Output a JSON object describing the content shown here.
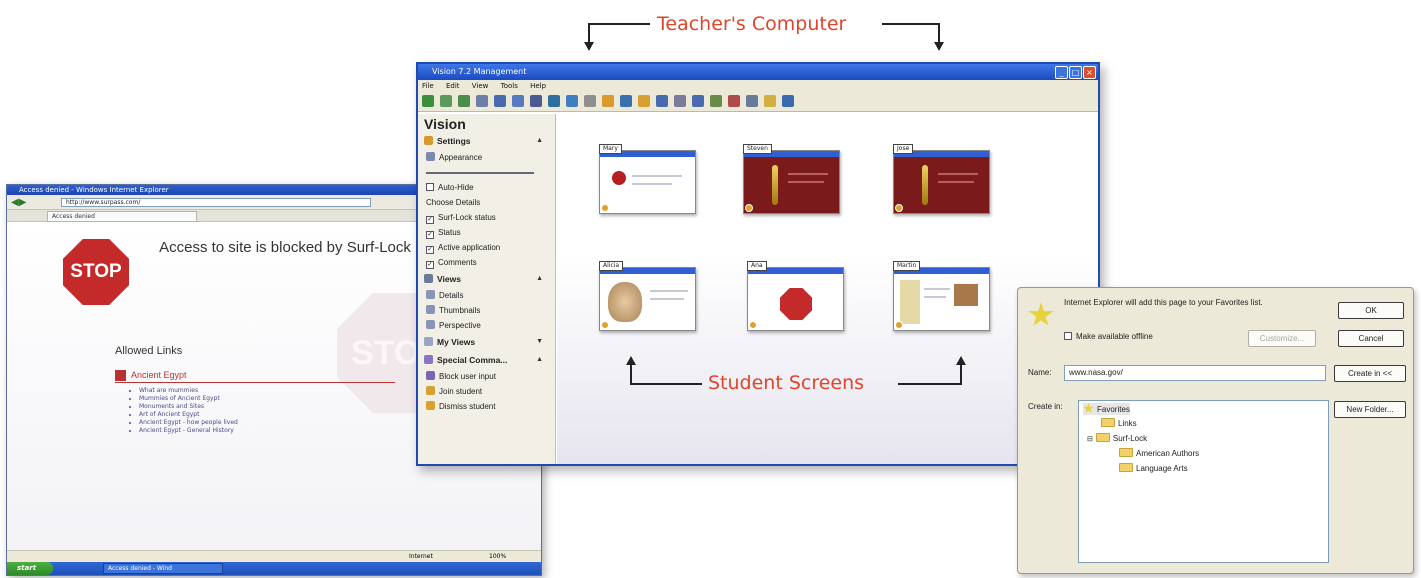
{
  "callouts": {
    "teacher": "Teacher's Computer",
    "students": "Student Screens"
  },
  "ie_window": {
    "title": "Access denied - Windows Internet Explorer",
    "address": "http://www.surpass.com/",
    "tab": "Access denied",
    "stop_label": "STOP",
    "blocked_message": "Access to site is blocked by Surf-Lock",
    "allowed_heading": "Allowed Links",
    "category": "Ancient Egypt",
    "links": [
      "What are mummies",
      "Mummies of Ancient Egypt",
      "Monuments and Sites",
      "Art of Ancient Egypt",
      "Ancient Egypt - how people lived",
      "Ancient Egypt - General History"
    ],
    "status_zone": "Internet",
    "status_zoom": "100%",
    "start_label": "start",
    "task_item": "Access denied - Wind"
  },
  "vision_window": {
    "title": "Vision 7.2 Management",
    "menu": [
      "File",
      "Edit",
      "View",
      "Tools",
      "Help"
    ],
    "toolbar_colors": [
      "#3b8f3b",
      "#5a9a5a",
      "#4c8c4c",
      "#6d7fa8",
      "#4a6ab0",
      "#5a7ac0",
      "#4a5a90",
      "#2f6f9f",
      "#3f7fbf",
      "#8f8f8f",
      "#d89a2a",
      "#3a6fb0",
      "#d8a030",
      "#4a6ab0",
      "#7a7a9a",
      "#4a6ab0",
      "#6a8a4a",
      "#b04a4a",
      "#6a7a9a",
      "#d0b040",
      "#3a6ab0"
    ],
    "sidebar": {
      "title": "Vision",
      "settings_head": "Settings",
      "appearance": "Appearance",
      "autohide": "Auto-Hide",
      "choose_details": "Choose Details",
      "details": [
        "Surf-Lock status",
        "Status",
        "Active application",
        "Comments"
      ],
      "views_head": "Views",
      "views": [
        "Details",
        "Thumbnails",
        "Perspective"
      ],
      "myviews_head": "My Views",
      "special_head": "Special Comma...",
      "special": [
        "Block user input",
        "Join student",
        "Dismiss student"
      ]
    },
    "thumbnails": [
      {
        "name": "Mary",
        "kind": "ie"
      },
      {
        "name": "Steven",
        "kind": "dark"
      },
      {
        "name": "Jose",
        "kind": "dark"
      },
      {
        "name": "Alicia",
        "kind": "face"
      },
      {
        "name": "Ana",
        "kind": "stop"
      },
      {
        "name": "Martin",
        "kind": "ie"
      }
    ]
  },
  "favorites_dialog": {
    "message": "Internet Explorer will add this page to your Favorites list.",
    "offline_label": "Make available offline",
    "customize": "Customize...",
    "ok": "OK",
    "cancel": "Cancel",
    "name_label": "Name:",
    "name_value": "www.nasa.gov/",
    "create_in_button": "Create in <<",
    "create_in_label": "Create in:",
    "new_folder": "New Folder...",
    "tree": [
      "Favorites",
      "Links",
      "Surf-Lock",
      "American Authors",
      "Language Arts"
    ]
  },
  "colors": {
    "callout": "#e0452b",
    "xp_blue": "#1f4ab0",
    "stop_red": "#c42a2a"
  }
}
